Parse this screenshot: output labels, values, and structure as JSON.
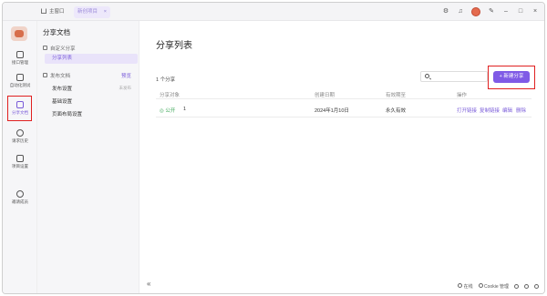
{
  "titlebar": {
    "home_tab": "主窗口",
    "active_tab": "新创项目",
    "active_tab_close": "×",
    "icons": [
      "settings-icon",
      "bell-icon",
      "avatar",
      "pin-icon",
      "minimize-icon",
      "maximize-icon",
      "close-icon"
    ]
  },
  "rail": {
    "items": [
      {
        "label": "接口管理",
        "icon": "api-icon"
      },
      {
        "label": "自动化测试",
        "icon": "test-icon"
      },
      {
        "label": "分享文档",
        "icon": "doc-icon"
      },
      {
        "label": "请求历史",
        "icon": "history-icon"
      },
      {
        "label": "项目设置",
        "icon": "settings-icon"
      },
      {
        "label": "邀请成员",
        "icon": "invite-icon"
      }
    ]
  },
  "sidebar": {
    "title": "分享文档",
    "group1": "自定义分享",
    "group1_items": [
      "分享列表"
    ],
    "group2": "发布文档",
    "group2_action": "预览",
    "group2_items": [
      {
        "label": "发布设置",
        "badge": "未发布"
      },
      {
        "label": "基础设置"
      },
      {
        "label": "页面布局设置"
      }
    ]
  },
  "main": {
    "title": "分享列表",
    "count": "1 个分享",
    "search_placeholder": "",
    "new_button": "+ 新建分享",
    "columns": [
      "分享对象",
      "创建日期",
      "有效期至",
      "操作"
    ],
    "rows": [
      {
        "status": "◎ 公开",
        "name": "1",
        "created": "2024年1月10日",
        "expires": "永久有效",
        "actions": [
          "打开链接",
          "复制链接",
          "编辑",
          "删除"
        ]
      }
    ]
  },
  "footer": {
    "collapse": "«",
    "online": "在线",
    "cookie": "Cookie 管理",
    "items": [
      "online-icon",
      "cookie-icon",
      "sync-icon",
      "shirt-icon",
      "help-icon"
    ]
  }
}
